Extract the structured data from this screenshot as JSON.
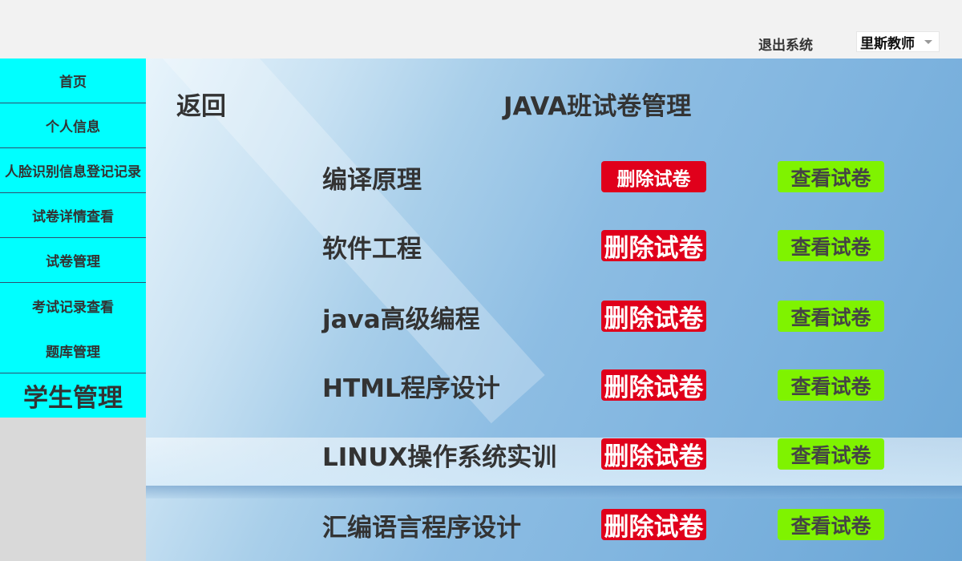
{
  "header": {
    "logout_label": "退出系统",
    "user_select_value": "里斯教师"
  },
  "sidebar": {
    "items": [
      {
        "label": "首页"
      },
      {
        "label": "个人信息"
      },
      {
        "label": "人脸识别信息登记记录"
      },
      {
        "label": "试卷详情查看"
      },
      {
        "label": "试卷管理"
      },
      {
        "label": "考试记录查看"
      },
      {
        "label": "题库管理"
      },
      {
        "label": "学生管理"
      }
    ]
  },
  "main": {
    "back_label": "返回",
    "title": "JAVA班试卷管理",
    "papers": [
      {
        "name": "编译原理",
        "delete_label": "删除试卷",
        "view_label": "查看试卷"
      },
      {
        "name": "软件工程",
        "delete_label": "删除试卷",
        "view_label": "查看试卷"
      },
      {
        "name": "java高级编程",
        "delete_label": "删除试卷",
        "view_label": "查看试卷"
      },
      {
        "name": "HTML程序设计",
        "delete_label": "删除试卷",
        "view_label": "查看试卷"
      },
      {
        "name": "LINUX操作系统实训",
        "delete_label": "删除试卷",
        "view_label": "查看试卷"
      },
      {
        "name": "汇编语言程序设计",
        "delete_label": "删除试卷",
        "view_label": "查看试卷"
      }
    ]
  },
  "colors": {
    "sidebar_item_bg": "#00ffff",
    "delete_button_bg": "#e0001b",
    "view_button_bg": "#7ff300"
  },
  "icons": {
    "user_select_caret": "chevron-down-icon"
  }
}
